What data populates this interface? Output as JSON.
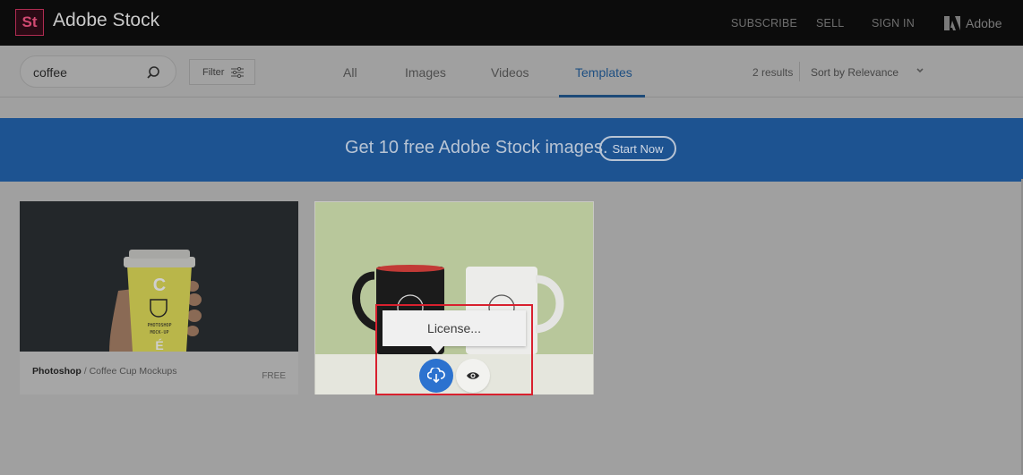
{
  "header": {
    "logo_mark": "St",
    "brand": "Adobe Stock",
    "links": [
      "SUBSCRIBE",
      "SELL",
      "SIGN IN"
    ],
    "adobe_label": "Adobe",
    "logo_color": "#b02c52"
  },
  "toolbar": {
    "search": {
      "value": "coffee",
      "placeholder": ""
    },
    "filter_label": "Filter",
    "tabs": [
      {
        "label": "All",
        "active": false
      },
      {
        "label": "Images",
        "active": false
      },
      {
        "label": "Videos",
        "active": false
      },
      {
        "label": "Templates",
        "active": true
      }
    ],
    "results_count": "2 results",
    "sort": {
      "selected": "Sort by Relevance"
    }
  },
  "banner": {
    "text": "Get 10 free Adobe Stock images.",
    "button_label": "Start Now",
    "color": "#1d5391"
  },
  "results": [
    {
      "app": "Photoshop",
      "separator": " / ",
      "title": "Coffee Cup Mockups",
      "price": "FREE",
      "image": "yellow-coffee-cup-in-hand",
      "cup_text": [
        "C",
        "PHOTOSHOP",
        "MOCK-UP"
      ]
    },
    {
      "image": "black-and-white-mugs",
      "hovered": true,
      "tooltip": "License...",
      "actions": [
        {
          "name": "license",
          "icon": "cloud-download-icon"
        },
        {
          "name": "preview",
          "icon": "eye-icon"
        }
      ]
    }
  ],
  "colors": {
    "accent_blue": "#2c72cf",
    "highlight_red": "#d8202e",
    "active_tab": "#1e4f82"
  }
}
